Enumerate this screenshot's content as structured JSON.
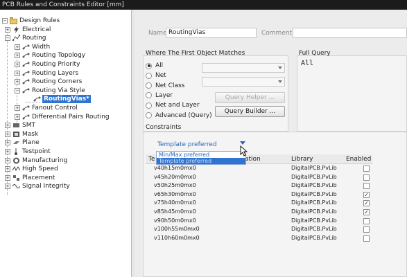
{
  "window": {
    "title": "PCB Rules and Constraints Editor [mm]"
  },
  "tree": {
    "items": [
      {
        "label": "Design Rules",
        "expander": "−",
        "icon": "folder-icon",
        "level": 0
      },
      {
        "label": "Electrical",
        "expander": "+",
        "icon": "electrical-icon",
        "level": 1
      },
      {
        "label": "Routing",
        "expander": "−",
        "icon": "routing-icon",
        "level": 1
      },
      {
        "label": "Width",
        "expander": "+",
        "icon": "rule-icon",
        "level": 2
      },
      {
        "label": "Routing Topology",
        "expander": "+",
        "icon": "rule-icon",
        "level": 2
      },
      {
        "label": "Routing Priority",
        "expander": "+",
        "icon": "rule-icon",
        "level": 2
      },
      {
        "label": "Routing Layers",
        "expander": "+",
        "icon": "rule-icon",
        "level": 2
      },
      {
        "label": "Routing Corners",
        "expander": "+",
        "icon": "rule-icon",
        "level": 2
      },
      {
        "label": "Routing Via Style",
        "expander": "−",
        "icon": "rule-icon",
        "level": 2
      },
      {
        "label": "RoutingVias*",
        "expander": "",
        "icon": "rule-icon",
        "level": 3,
        "selected": true
      },
      {
        "label": "Fanout Control",
        "expander": "+",
        "icon": "rule-icon",
        "level": 2
      },
      {
        "label": "Differential Pairs Routing",
        "expander": "+",
        "icon": "rule-icon",
        "level": 2
      },
      {
        "label": "SMT",
        "expander": "+",
        "icon": "smt-icon",
        "level": 1
      },
      {
        "label": "Mask",
        "expander": "+",
        "icon": "mask-icon",
        "level": 1
      },
      {
        "label": "Plane",
        "expander": "+",
        "icon": "plane-icon",
        "level": 1
      },
      {
        "label": "Testpoint",
        "expander": "+",
        "icon": "testpoint-icon",
        "level": 1
      },
      {
        "label": "Manufacturing",
        "expander": "+",
        "icon": "manufacturing-icon",
        "level": 1
      },
      {
        "label": "High Speed",
        "expander": "+",
        "icon": "high-speed-icon",
        "level": 1
      },
      {
        "label": "Placement",
        "expander": "+",
        "icon": "placement-icon",
        "level": 1
      },
      {
        "label": "Signal Integrity",
        "expander": "+",
        "icon": "signal-integrity-icon",
        "level": 1
      }
    ]
  },
  "rule": {
    "name_label": "Name",
    "name_value": "RoutingVias",
    "comment_label": "Comment",
    "comment_value": ""
  },
  "where": {
    "title": "Where The First Object Matches",
    "options": [
      {
        "label": "All",
        "checked": true
      },
      {
        "label": "Net",
        "checked": false
      },
      {
        "label": "Net Class",
        "checked": false
      },
      {
        "label": "Layer",
        "checked": false
      },
      {
        "label": "Net and Layer",
        "checked": false
      },
      {
        "label": "Advanced (Query)",
        "checked": false
      }
    ],
    "query_helper": "Query Helper ...",
    "query_builder": "Query Builder ..."
  },
  "full_query": {
    "title": "Full Query",
    "text": "All"
  },
  "constraints": {
    "title": "Constraints",
    "style_selected": "Template preferred",
    "style_options": [
      "Min/Max preferred",
      "Template preferred"
    ],
    "columns": [
      "Te",
      "ation",
      "Library",
      "Enabled"
    ],
    "rows": [
      {
        "name": "v40h15m0mx0",
        "library": "DigitalPCB.PvLib",
        "enabled": false
      },
      {
        "name": "v45h20m0mx0",
        "library": "DigitalPCB.PvLib",
        "enabled": false
      },
      {
        "name": "v50h25m0mx0",
        "library": "DigitalPCB.PvLib",
        "enabled": false
      },
      {
        "name": "v65h30m0mx0",
        "library": "DigitalPCB.PvLib",
        "enabled": true
      },
      {
        "name": "v75h40m0mx0",
        "library": "DigitalPCB.PvLib",
        "enabled": true
      },
      {
        "name": "v85h45m0mx0",
        "library": "DigitalPCB.PvLib",
        "enabled": true
      },
      {
        "name": "v90h50m0mx0",
        "library": "DigitalPCB.PvLib",
        "enabled": false
      },
      {
        "name": "v100h55m0mx0",
        "library": "DigitalPCB.PvLib",
        "enabled": false
      },
      {
        "name": "v110h60m0mx0",
        "library": "DigitalPCB.PvLib",
        "enabled": false
      }
    ]
  },
  "colors": {
    "selection": "#2f74d0",
    "link": "#2a64b8"
  }
}
